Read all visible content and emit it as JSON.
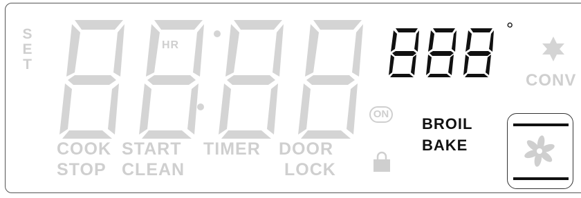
{
  "set_label": [
    "S",
    "E",
    "T"
  ],
  "clock": {
    "hr_label": "HR"
  },
  "temperature": {
    "degree_symbol": "°"
  },
  "conv_label": "CONV",
  "indicators": {
    "cook": "COOK",
    "stop": "STOP",
    "start": "START",
    "clean": "CLEAN",
    "timer": "TIMER",
    "door": "DOOR",
    "lock": "LOCK",
    "on": "ON",
    "broil": "BROIL",
    "bake": "BAKE"
  },
  "icons": {
    "conv": "star-icon",
    "lock": "padlock-icon",
    "fan": "fan-icon"
  },
  "colors": {
    "inactive": "#cfcfcf",
    "active": "#111111",
    "border": "#555555"
  }
}
